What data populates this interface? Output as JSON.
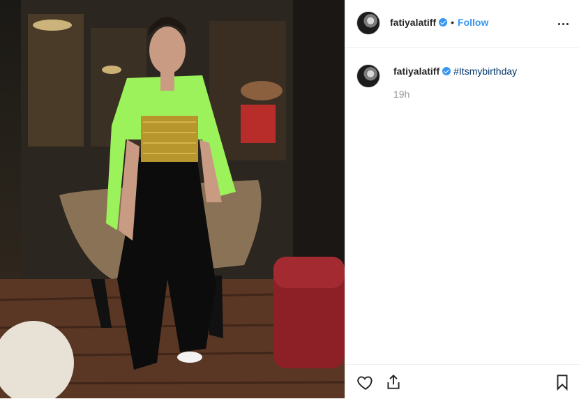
{
  "post": {
    "username": "fatiyalatiff",
    "verified": true,
    "follow_label": "Follow",
    "separator": "•",
    "caption_hashtag": "#Itsmybirthday",
    "timestamp": "19h"
  },
  "icons": {
    "more": "more-options-icon",
    "like": "heart-icon",
    "share": "share-icon",
    "save": "bookmark-icon"
  },
  "colors": {
    "accent": "#3897f0",
    "hashtag": "#003569",
    "muted": "#999999"
  }
}
